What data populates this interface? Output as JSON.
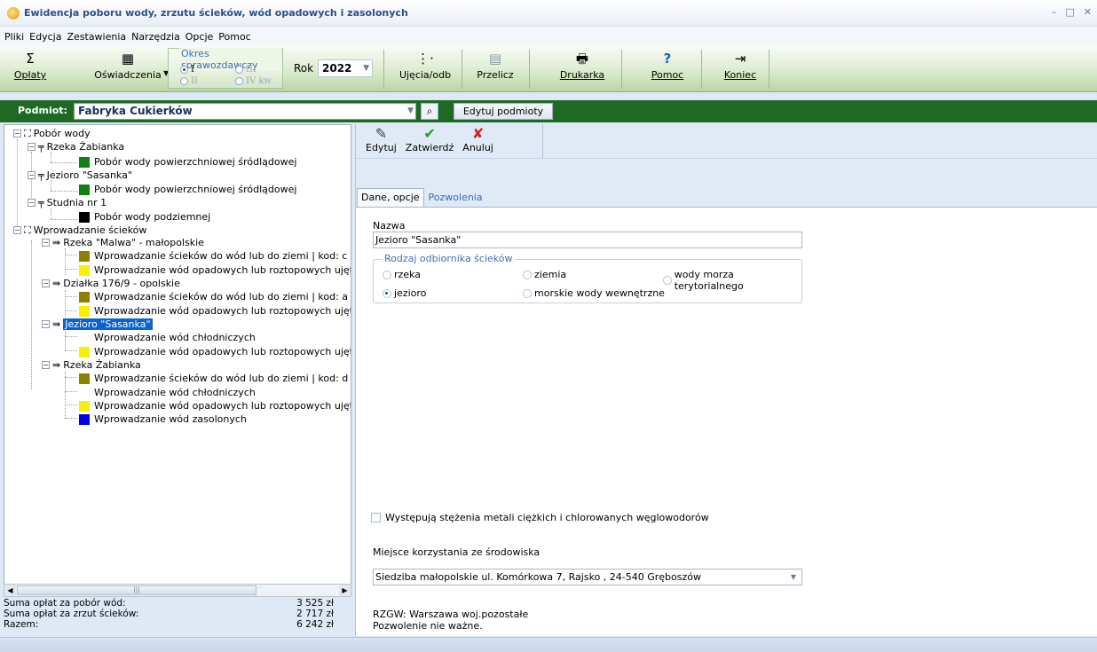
{
  "window": {
    "title": "Ewidencja poboru wody, zrzutu ścieków, wód opadowych i zasolonych",
    "min": "–",
    "max": "□",
    "close": "✕"
  },
  "menu": [
    "Pliki",
    "Edycja",
    "Zestawienia",
    "Narzędzia",
    "Opcje",
    "Pomoc"
  ],
  "ribbon": {
    "oplaty": "Opłaty",
    "oswiadczenia": "Oświadczenia",
    "okres_label": "Okres sprawozdawczy",
    "okres": {
      "i": "I",
      "ii": "II",
      "iii": "III",
      "iv": "IV kw",
      "selected": "I"
    },
    "rok_label": "Rok",
    "rok_value": "2022",
    "ujecia": "Ujęcia/odb",
    "przelicz": "Przelicz",
    "drukarka": "Drukarka",
    "pomoc": "Pomoc",
    "koniec": "Koniec"
  },
  "podmiot": {
    "label": "Podmiot:",
    "value": "Fabryka Cukierków",
    "edit_button": "Edytuj podmioty"
  },
  "tree": {
    "pobor": "Pobór wody",
    "rzeka_zabianka": "Rzeka Żabianka",
    "pobor_pow": "Pobór wody powierzchniowej śródlądowej",
    "jezioro_sasanka": "Jezioro \"Sasanka\"",
    "studnia": "Studnia nr 1",
    "pobor_podz": "Pobór wody podziemnej",
    "wprowadzanie": "Wprowadzanie ścieków",
    "rzeka_malwa": "Rzeka \"Malwa\" - małopolskie",
    "wpr_sciekow_c": "Wprowadzanie ścieków do wód lub do ziemi | kod: c",
    "wpr_opad": "Wprowadzanie wód opadowych lub roztopowych ujęty",
    "dzialka": "Działka 176/9 - opolskie",
    "wpr_sciekow_a": "Wprowadzanie ścieków do wód lub do ziemi | kod: a",
    "jezioro_sel": "Jezioro \"Sasanka\"",
    "wpr_chlodn": "Wprowadzanie wód chłodniczych",
    "wpr_sciekow_d": "Wprowadzanie ścieków do wód lub do ziemi | kod: d",
    "wpr_zasol": "Wprowadzanie wód zasolonych"
  },
  "sums": {
    "pobor_label": "Suma opłat za pobór wód:",
    "pobor_value": "3 525 zł",
    "zrzut_label": "Suma opłat za zrzut ścieków:",
    "zrzut_value": "2 717 zł",
    "razem_label": "Razem:",
    "razem_value": "6 242 zł"
  },
  "toolbar": {
    "edytuj": "Edytuj",
    "zatwierdz": "Zatwierdź",
    "anuluj": "Anuluj"
  },
  "tabs": {
    "dane": "Dane, opcje",
    "pozwolenia": "Pozwolenia"
  },
  "form": {
    "nazwa_label": "Nazwa",
    "nazwa_value": "Jezioro \"Sasanka\"",
    "rodzaj_label": "Rodzaj odbiornika ścieków",
    "opt_rzeka": "rzeka",
    "opt_ziemia": "ziemia",
    "opt_morza": "wody morza terytorialnego",
    "opt_jezioro": "jezioro",
    "opt_morskie": "morskie wody wewnętrzne",
    "selected": "jezioro",
    "metale_label": "Występują stężenia metali ciężkich  i chlorowanych węglowodorów",
    "miejsce_label": "Miejsce korzystania ze środowiska",
    "miejsce_value": "Siedziba małopolskie ul. Komórkowa 7, Rajsko , 24-540 Gręboszów",
    "rzgw": "RZGW: Warszawa woj.pozostałe",
    "pozwolenie": "Pozwolenie nie ważne."
  }
}
